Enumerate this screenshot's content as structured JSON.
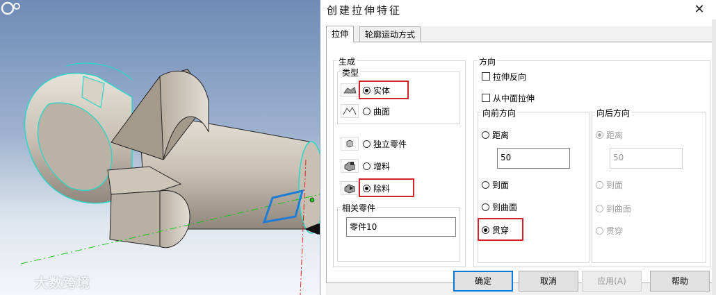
{
  "watermark": {
    "text": "大数跨境"
  },
  "dialog": {
    "title": "创建拉伸特征",
    "close_glyph": "✕",
    "tabs": [
      "拉伸",
      "轮廓运动方式"
    ],
    "generate": {
      "label": "生成",
      "type_label": "类型",
      "types": [
        "实体",
        "曲面"
      ],
      "selected_type": "实体",
      "ops": [
        "独立零件",
        "增料",
        "除料"
      ],
      "selected_op": "除料",
      "related_label": "相关零件",
      "related_value": "零件10"
    },
    "direction": {
      "label": "方向",
      "reverse_label": "拉伸反向",
      "midplane_label": "从中面拉伸",
      "forward": {
        "label": "向前方向",
        "options": [
          "距离",
          "到面",
          "到曲面",
          "贯穿"
        ],
        "selected": "贯穿",
        "distance_value": "50"
      },
      "backward": {
        "label": "向后方向",
        "options": [
          "距离",
          "到面",
          "到曲面",
          "贯穿"
        ],
        "selected": "距离",
        "distance_value": "50"
      }
    },
    "buttons": {
      "ok": "确定",
      "cancel": "取消",
      "apply": "应用(A)",
      "help": "帮助"
    },
    "colors": {
      "highlight_box": "#d2232a",
      "default_button_border": "#0078d7"
    }
  }
}
